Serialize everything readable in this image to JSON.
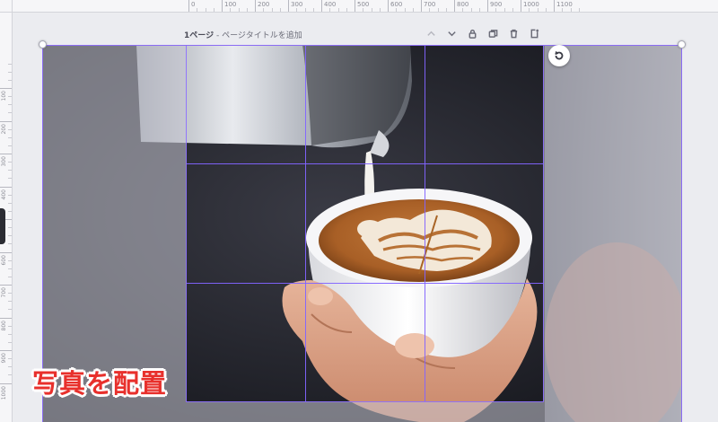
{
  "ruler": {
    "x_labels": [
      "0",
      "100",
      "200",
      "300",
      "400",
      "500",
      "600",
      "700",
      "800",
      "900",
      "1000",
      "1100"
    ],
    "y_labels": [
      "100",
      "200",
      "300",
      "400",
      "500",
      "600",
      "700",
      "800",
      "900",
      "1000"
    ]
  },
  "page": {
    "label": "1ページ",
    "separator": " - ",
    "title_placeholder": "ページタイトルを追加"
  },
  "actions": [
    {
      "name": "move-up-icon"
    },
    {
      "name": "move-down-icon"
    },
    {
      "name": "lock-icon"
    },
    {
      "name": "duplicate-icon"
    },
    {
      "name": "trash-icon"
    },
    {
      "name": "add-page-icon"
    }
  ],
  "caption": "写真を配置",
  "colors": {
    "accent": "#8b6cf4",
    "caption": "#e8302c",
    "grid": "#8264ff"
  }
}
